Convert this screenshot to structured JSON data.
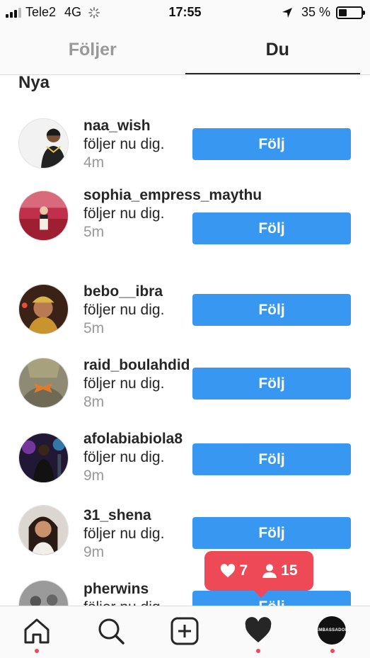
{
  "status_bar": {
    "carrier": "Tele2",
    "network": "4G",
    "time": "17:55",
    "battery": "35 %",
    "battery_level": 0.35
  },
  "tabs": [
    {
      "label": "Följer",
      "active": false
    },
    {
      "label": "Du",
      "active": true
    }
  ],
  "section_title": "Nya",
  "notifications": [
    {
      "username": "naa_wish",
      "text": " följer nu dig.",
      "time": " 4m",
      "button": "Följ"
    },
    {
      "username": "sophia_empress_maythu",
      "text": " följer nu dig.",
      "time": " 5m",
      "button": "Följ"
    },
    {
      "username": "bebo__ibra",
      "text": " följer nu dig.",
      "time": " 5m",
      "button": "Följ"
    },
    {
      "username": "raid_boulahdid",
      "text": " följer nu dig.",
      "time": " 8m",
      "button": "Följ"
    },
    {
      "username": "afolabiabiola8",
      "text": " följer nu dig.",
      "time": " 9m",
      "button": "Följ"
    },
    {
      "username": "31_shena",
      "text": " följer nu dig.",
      "time": " 9m",
      "button": "Följ"
    },
    {
      "username": "pherwins",
      "text": " följer nu dig.",
      "time": "",
      "button": "Följ"
    }
  ],
  "activity_popup": {
    "likes": "7",
    "followers": "15"
  },
  "profile_badge_text": "AMBASSADOR",
  "colors": {
    "accent": "#3897f0",
    "badge": "#ed4956"
  },
  "icons": {
    "nav": [
      "home-icon",
      "search-icon",
      "add-post-icon",
      "activity-heart-icon",
      "profile-avatar"
    ]
  }
}
